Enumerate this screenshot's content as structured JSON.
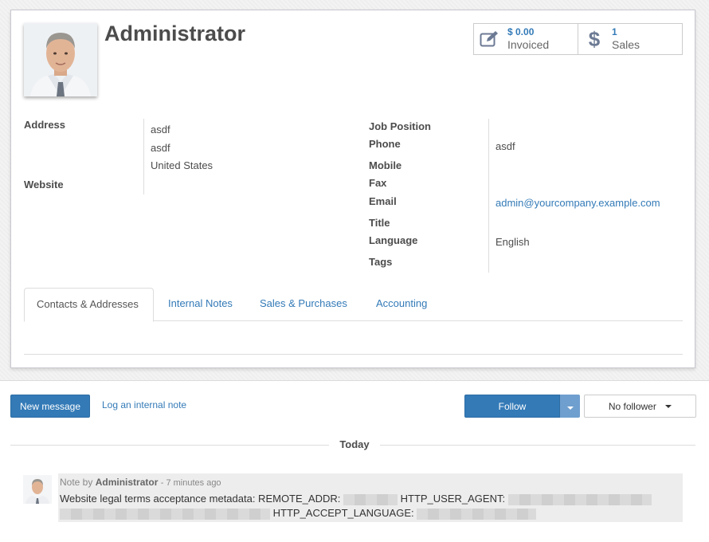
{
  "record": {
    "name": "Administrator",
    "stats": [
      {
        "value": "$ 0.00",
        "label": "Invoiced",
        "icon": "pencil-square-icon"
      },
      {
        "value": "1",
        "label": "Sales",
        "icon": "dollar-icon"
      }
    ]
  },
  "fields_left": {
    "address_label": "Address",
    "address_lines": [
      "asdf",
      "asdf",
      "United States"
    ],
    "website_label": "Website"
  },
  "fields_right": {
    "job_position_label": "Job Position",
    "phone_label": "Phone",
    "phone_value": "asdf",
    "mobile_label": "Mobile",
    "fax_label": "Fax",
    "email_label": "Email",
    "email_value": "admin@yourcompany.example.com",
    "title_label": "Title",
    "language_label": "Language",
    "language_value": "English",
    "tags_label": "Tags"
  },
  "tabs": [
    {
      "label": "Contacts & Addresses",
      "active": true
    },
    {
      "label": "Internal Notes",
      "active": false
    },
    {
      "label": "Sales & Purchases",
      "active": false
    },
    {
      "label": "Accounting",
      "active": false
    }
  ],
  "chatter": {
    "new_message": "New message",
    "log_note": "Log an internal note",
    "follow": "Follow",
    "followers": "No follower",
    "date_separator": "Today",
    "message": {
      "prefix": "Note by",
      "author": "Administrator",
      "time": "- 7 minutes ago",
      "body_1": "Website legal terms acceptance metadata: REMOTE_ADDR:",
      "body_2": "HTTP_USER_AGENT:",
      "body_3": "HTTP_ACCEPT_LANGUAGE:"
    }
  },
  "colors": {
    "primary": "#337ab7",
    "link": "#337ab7",
    "text": "#4c4c4c"
  }
}
